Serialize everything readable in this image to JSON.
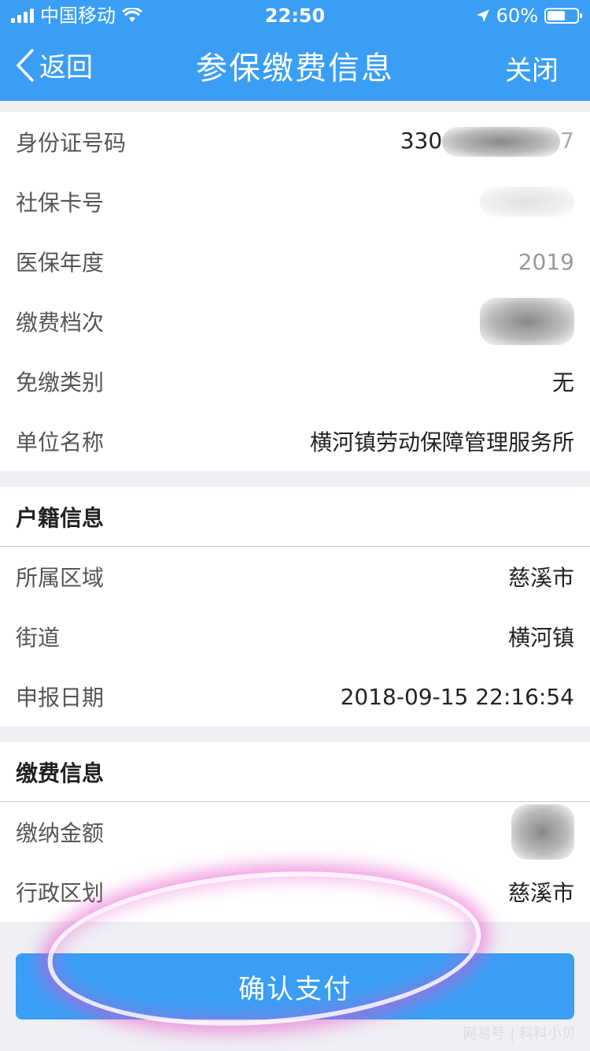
{
  "status_bar": {
    "carrier": "中国移动",
    "time": "22:50",
    "battery": "60%",
    "battery_level": 0.6
  },
  "nav": {
    "back_label": "返回",
    "title": "参保缴费信息",
    "close_label": "关闭"
  },
  "basic_info": {
    "rows": [
      {
        "label": "身份证号码",
        "value_prefix": "330",
        "value_suffix": "7"
      },
      {
        "label": "社保卡号"
      },
      {
        "label": "医保年度",
        "value": "2019"
      },
      {
        "label": "缴费档次"
      },
      {
        "label": "免缴类别",
        "value": "无"
      },
      {
        "label": "单位名称",
        "value": "横河镇劳动保障管理服务所"
      }
    ]
  },
  "household": {
    "heading": "户籍信息",
    "rows": [
      {
        "label": "所属区域",
        "value": "慈溪市"
      },
      {
        "label": "街道",
        "value": "横河镇"
      },
      {
        "label": "申报日期",
        "value": "2018-09-15 22:16:54"
      }
    ]
  },
  "payment": {
    "heading": "缴费信息",
    "rows": [
      {
        "label": "缴纳金额"
      },
      {
        "label": "行政区划",
        "value": "慈溪市"
      }
    ]
  },
  "footer": {
    "confirm_label": "确认支付"
  },
  "watermark": "网易号 | 科科小贝",
  "colors": {
    "accent": "#3a9ef5",
    "background": "#efeff4"
  }
}
